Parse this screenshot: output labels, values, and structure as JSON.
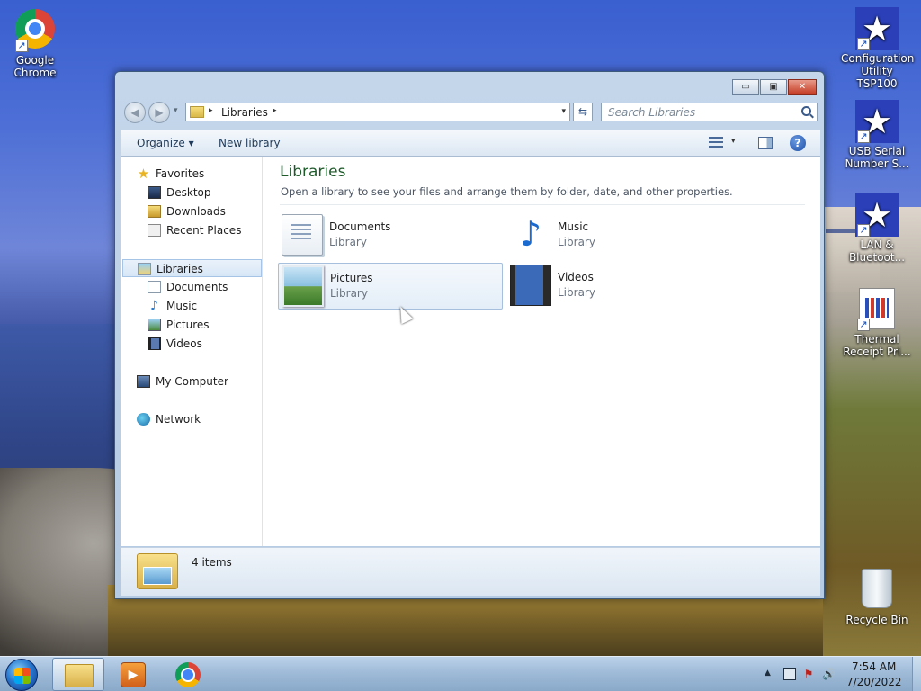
{
  "desktop": {
    "icons": [
      {
        "label": "Google Chrome",
        "icon": "chrome-icon"
      },
      {
        "label": "Configuration Utility TSP100",
        "icon": "star-shortcut-icon"
      },
      {
        "label": "USB Serial Number S...",
        "icon": "star-shortcut-icon"
      },
      {
        "label": "LAN & Bluetoot...",
        "icon": "star-shield-icon"
      },
      {
        "label": "Thermal Receipt Pri...",
        "icon": "document-icon"
      },
      {
        "label": "Recycle Bin",
        "icon": "recycle-bin-icon"
      }
    ]
  },
  "window": {
    "caption": {
      "minimize": "▭",
      "maximize": "▣",
      "close": "✕"
    },
    "navigation": {
      "back": "◀",
      "forward": "▶"
    },
    "address": {
      "segment": "Libraries",
      "separator": "▸",
      "dropdown": "▾"
    },
    "refresh": "⇆",
    "search": {
      "placeholder": "Search Libraries"
    },
    "toolbar": {
      "organize": "Organize ▾",
      "new_library": "New library",
      "views_dropdown": "▾",
      "help": "?"
    },
    "nav_pane": {
      "favorites": "Favorites",
      "favorites_items": [
        "Desktop",
        "Downloads",
        "Recent Places"
      ],
      "libraries": "Libraries",
      "libraries_items": [
        "Documents",
        "Music",
        "Pictures",
        "Videos"
      ],
      "my_computer": "My Computer",
      "network": "Network"
    },
    "main": {
      "title": "Libraries",
      "description": "Open a library to see your files and arrange them by folder, date, and other properties.",
      "tiles": [
        {
          "name": "Documents",
          "subtitle": "Library",
          "icon": "documents-library-icon"
        },
        {
          "name": "Music",
          "subtitle": "Library",
          "icon": "music-library-icon"
        },
        {
          "name": "Pictures",
          "subtitle": "Library",
          "icon": "pictures-library-icon",
          "selected": true
        },
        {
          "name": "Videos",
          "subtitle": "Library",
          "icon": "videos-library-icon"
        }
      ]
    },
    "details": {
      "item_count": "4 items"
    }
  },
  "taskbar": {
    "tray_arrow": "▲",
    "tray_flag": "⚑",
    "tray_volume": "🔊",
    "time": "7:54 AM",
    "date": "7/20/2022"
  },
  "colors": {
    "title_green": "#1e5a2a",
    "selection_border": "#a6bfdc",
    "taskbar": "#9fbbd8"
  }
}
